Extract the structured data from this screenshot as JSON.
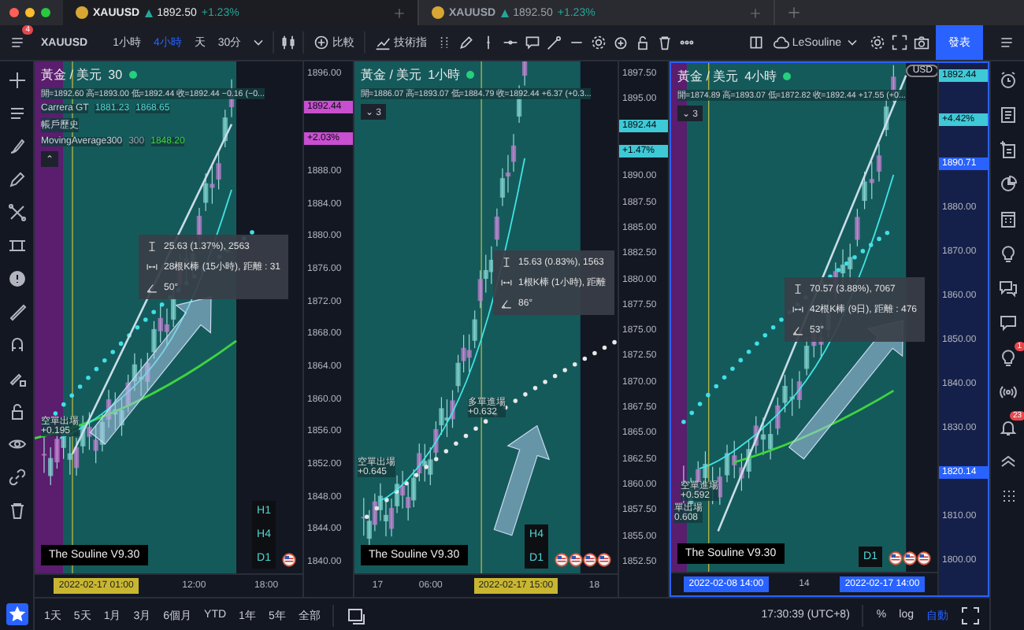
{
  "window": {
    "tabs": [
      {
        "symbol": "XAUUSD",
        "price": "1892.50",
        "change": "+1.23%",
        "selected": true
      },
      {
        "symbol": "XAUUSD",
        "price": "1892.50",
        "change": "+1.23%",
        "selected": false
      }
    ]
  },
  "toolbar": {
    "menu_badge": "4",
    "symbol": "XAUUSD",
    "intervals": [
      {
        "label": "1小時",
        "selected": false
      },
      {
        "label": "4小時",
        "selected": true
      },
      {
        "label": "天",
        "selected": false
      },
      {
        "label": "30分",
        "selected": false
      }
    ],
    "compare": "比較",
    "indicators": "技術指",
    "layout": "LeSouline",
    "publish": "發表"
  },
  "panes": [
    {
      "title": "黃金 / 美元",
      "interval": "30",
      "selected": false,
      "ohlc": "開=1892.60 高=1893.00 低=1892.44 收=1892.44 −0.16 (−0...",
      "legend": [
        {
          "name": "Carrera GT",
          "values": [
            {
              "text": "1881.23",
              "color": "#4fd6d6"
            },
            {
              "text": "1868.65",
              "color": "#4fd6d6"
            }
          ]
        },
        {
          "name": "帳戶歷史"
        },
        {
          "name": "MovingAverage300",
          "values": [
            {
              "text": "300",
              "color": "#9aa0aa"
            },
            {
              "text": "1848.20",
              "color": "#3fd43f"
            }
          ]
        }
      ],
      "collapse": "⌃",
      "measure": {
        "range": "25.63 (1.37%), 2563",
        "bars": "28根K棒 (15小時), 距離 : 31",
        "angle": "50°"
      },
      "signals": [
        {
          "label": "空單出場",
          "value": "+0.195"
        }
      ],
      "indicator_label": "The Souline V9.30",
      "timeframes": [
        "H1",
        "H4",
        "D1"
      ],
      "price_axis": [
        {
          "label": "1896.00",
          "kind": "tick"
        },
        {
          "label": "1892.44",
          "kind": "last",
          "color": "#c84fd0"
        },
        {
          "label": "+2.03%",
          "kind": "change",
          "color": "#c84fd0"
        },
        {
          "label": "1888.00",
          "kind": "tick"
        },
        {
          "label": "1884.00",
          "kind": "tick"
        },
        {
          "label": "1880.00",
          "kind": "tick"
        },
        {
          "label": "1876.00",
          "kind": "tick"
        },
        {
          "label": "1872.00",
          "kind": "tick"
        },
        {
          "label": "1868.00",
          "kind": "tick"
        },
        {
          "label": "1864.00",
          "kind": "tick"
        },
        {
          "label": "1860.00",
          "kind": "tick"
        },
        {
          "label": "1856.00",
          "kind": "tick"
        },
        {
          "label": "1852.00",
          "kind": "tick"
        },
        {
          "label": "1848.00",
          "kind": "tick"
        },
        {
          "label": "1844.00",
          "kind": "tick"
        },
        {
          "label": "1840.00",
          "kind": "tick"
        }
      ],
      "time_axis": [
        {
          "label": "2022-02-17  01:00",
          "kind": "cursor"
        },
        {
          "label": "12:00",
          "kind": "tick"
        },
        {
          "label": "18:00",
          "kind": "tick"
        }
      ]
    },
    {
      "title": "黃金 / 美元",
      "interval": "1小時",
      "selected": false,
      "ohlc": "開=1886.07 高=1893.07 低=1884.79 收=1892.44 +6.37 (+0.3...",
      "collapse": "⌄ 3",
      "measure": {
        "range": "15.63 (0.83%), 1563",
        "bars": "1根K棒 (1小時), 距離",
        "angle": "86°"
      },
      "signals": [
        {
          "label": "多單進場",
          "value": "+0.632"
        },
        {
          "label": "空單出場",
          "value": "+0.645"
        }
      ],
      "indicator_label": "The Souline V9.30",
      "timeframes": [
        "H4",
        "D1"
      ],
      "price_axis": [
        {
          "label": "1897.50",
          "kind": "tick"
        },
        {
          "label": "1895.00",
          "kind": "tick"
        },
        {
          "label": "1892.44",
          "kind": "last",
          "color": "#3ec9d6"
        },
        {
          "label": "+1.47%",
          "kind": "change",
          "color": "#3ec9d6"
        },
        {
          "label": "1890.00",
          "kind": "tick"
        },
        {
          "label": "1887.50",
          "kind": "tick"
        },
        {
          "label": "1885.00",
          "kind": "tick"
        },
        {
          "label": "1882.50",
          "kind": "tick"
        },
        {
          "label": "1880.00",
          "kind": "tick"
        },
        {
          "label": "1877.50",
          "kind": "tick"
        },
        {
          "label": "1875.00",
          "kind": "tick"
        },
        {
          "label": "1872.50",
          "kind": "tick"
        },
        {
          "label": "1870.00",
          "kind": "tick"
        },
        {
          "label": "1867.50",
          "kind": "tick"
        },
        {
          "label": "1865.00",
          "kind": "tick"
        },
        {
          "label": "1862.50",
          "kind": "tick"
        },
        {
          "label": "1860.00",
          "kind": "tick"
        },
        {
          "label": "1857.50",
          "kind": "tick"
        },
        {
          "label": "1855.00",
          "kind": "tick"
        },
        {
          "label": "1852.50",
          "kind": "tick"
        }
      ],
      "time_axis": [
        {
          "label": "17",
          "kind": "tick"
        },
        {
          "label": "06:00",
          "kind": "tick"
        },
        {
          "label": "2022-02-17  15:00",
          "kind": "cursor"
        },
        {
          "label": "18",
          "kind": "tick"
        }
      ]
    },
    {
      "title": "黃金 / 美元",
      "interval": "4小時",
      "selected": true,
      "ohlc": "開=1874.89 高=1893.07 低=1872.82 收=1892.44 +17.55 (+0...",
      "collapse": "⌄ 3",
      "currency": "USD",
      "measure": {
        "range": "70.57 (3.88%), 7067",
        "bars": "42根K棒 (9日), 距離 : 476",
        "angle": "53°"
      },
      "signals": [
        {
          "label": "空單進場",
          "value": "+0.592"
        },
        {
          "label": "單出場",
          "value": "0.608"
        }
      ],
      "indicator_label": "The Souline V9.30",
      "timeframes": [
        "D1"
      ],
      "price_axis": [
        {
          "label": "1892.44",
          "kind": "last",
          "color": "#3ec9d6"
        },
        {
          "label": "+4.42%",
          "kind": "change",
          "color": "#3ec9d6"
        },
        {
          "label": "1890.71",
          "kind": "level"
        },
        {
          "label": "1880.00",
          "kind": "tick"
        },
        {
          "label": "1870.00",
          "kind": "tick"
        },
        {
          "label": "1860.00",
          "kind": "tick"
        },
        {
          "label": "1850.00",
          "kind": "tick"
        },
        {
          "label": "1840.00",
          "kind": "tick"
        },
        {
          "label": "1830.00",
          "kind": "tick"
        },
        {
          "label": "1820.14",
          "kind": "level"
        },
        {
          "label": "1810.00",
          "kind": "tick"
        },
        {
          "label": "1800.00",
          "kind": "tick"
        }
      ],
      "time_axis": [
        {
          "label": "2022-02-08  14:00",
          "kind": "range"
        },
        {
          "label": "14",
          "kind": "tick"
        },
        {
          "label": "2022-02-17  14:00",
          "kind": "range"
        }
      ]
    }
  ],
  "bottom_bar": {
    "ranges": [
      "1天",
      "5天",
      "1月",
      "3月",
      "6個月",
      "YTD",
      "1年",
      "5年",
      "全部"
    ],
    "clock": "17:30:39 (UTC+8)",
    "percent": "%",
    "log": "log",
    "auto": {
      "label": "自動",
      "selected": true
    }
  },
  "right_sidebar": {
    "ideas_badge": "1",
    "alerts_badge": "23"
  }
}
